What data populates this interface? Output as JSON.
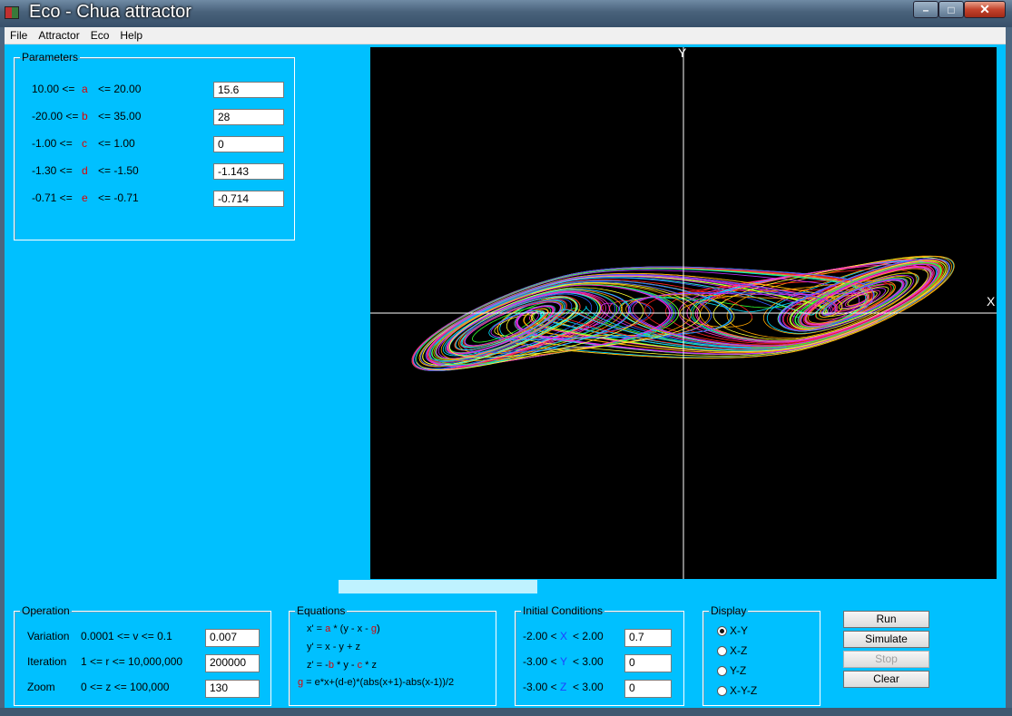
{
  "window": {
    "title": "Eco - Chua attractor",
    "minimize": "–",
    "maximize": "□",
    "close": "✕"
  },
  "menu": [
    "File",
    "Attractor",
    "Eco",
    "Help"
  ],
  "parameters": {
    "legend": "Parameters",
    "rows": [
      {
        "min": "10.00 <=",
        "name": "a",
        "max": "<= 20.00",
        "value": "15.6"
      },
      {
        "min": "-20.00 <=",
        "name": "b",
        "max": "<= 35.00",
        "value": "28"
      },
      {
        "min": "-1.00 <=",
        "name": "c",
        "max": "<= 1.00",
        "value": "0"
      },
      {
        "min": "-1.30 <=",
        "name": "d",
        "max": "<= -1.50",
        "value": "-1.143"
      },
      {
        "min": "-0.71 <=",
        "name": "e",
        "max": "<= -0.71",
        "value": "-0.714"
      }
    ]
  },
  "plot": {
    "y_axis_label": "Y",
    "x_axis_label": "X",
    "background": "#000000"
  },
  "progress": {
    "fraction": 0.3
  },
  "operation": {
    "legend": "Operation",
    "rows": [
      {
        "label": "Variation",
        "range": "0.0001 <= v <= 0.1",
        "value": "0.007"
      },
      {
        "label": "Iteration",
        "range": "1 <= r <= 10,000,000",
        "value": "200000"
      },
      {
        "label": "Zoom",
        "range": "0 <= z <= 100,000",
        "value": "130"
      }
    ]
  },
  "equations": {
    "legend": "Equations",
    "x": {
      "a": "x' = ",
      "b": "a",
      "c": " * (y - x - ",
      "d": "g",
      "e": ")"
    },
    "y": "y' = x - y + z",
    "z": {
      "a": "z' = -",
      "b": "b",
      "c": " * y - ",
      "d": "c",
      "e": " * z"
    },
    "g": {
      "a": "g",
      "b": " = e*x+(d-e)*(abs(x+1)-abs(x-1))/2"
    }
  },
  "initial_conditions": {
    "legend": "Initial Conditions",
    "rows": [
      {
        "min": "-2.00 <",
        "var": "X",
        "max": "< 2.00",
        "value": "0.7"
      },
      {
        "min": "-3.00 <",
        "var": "Y",
        "max": "< 3.00",
        "value": "0"
      },
      {
        "min": "-3.00 <",
        "var": "Z",
        "max": "< 3.00",
        "value": "0"
      }
    ]
  },
  "display": {
    "legend": "Display",
    "options": [
      "X-Y",
      "X-Z",
      "Y-Z",
      "X-Y-Z"
    ],
    "selected": "X-Y"
  },
  "buttons": {
    "run": "Run",
    "simulate": "Simulate",
    "stop": "Stop",
    "clear": "Clear"
  },
  "colors": {
    "client": "#00c0ff",
    "accent_red": "#e00000",
    "accent_blue": "#2040ff"
  }
}
